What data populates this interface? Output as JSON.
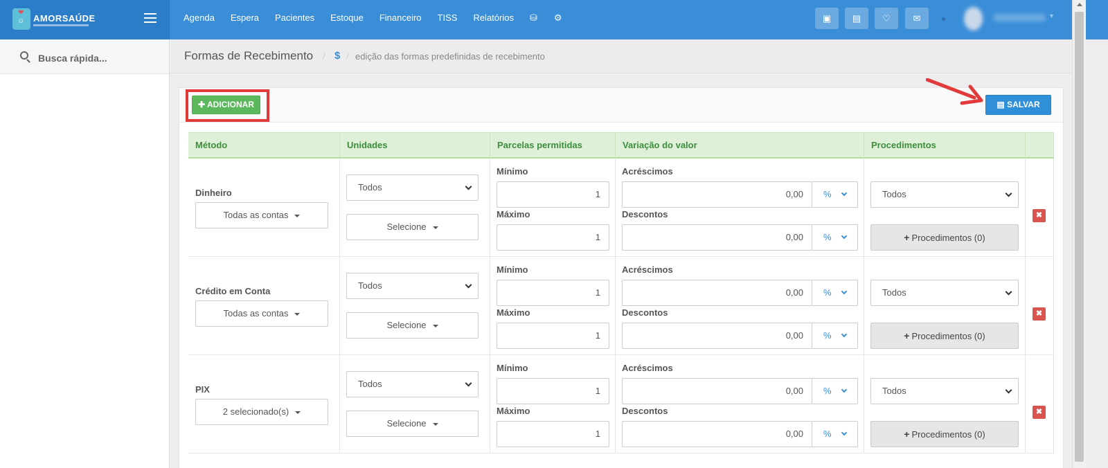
{
  "brand": {
    "name": "AMORSAÚDE"
  },
  "nav": {
    "items": [
      "Agenda",
      "Espera",
      "Pacientes",
      "Estoque",
      "Financeiro",
      "TISS",
      "Relatórios"
    ],
    "icons": [
      "database-icon",
      "gear-icon"
    ]
  },
  "topbar_buttons": [
    "inbox-icon",
    "card-icon",
    "bell-icon",
    "chat-icon"
  ],
  "sidebar": {
    "search_label": "Busca rápida..."
  },
  "page": {
    "title": "Formas de Recebimento",
    "breadcrumb_icon": "$",
    "breadcrumb": "edição das formas predefinidas de recebimento"
  },
  "toolbar": {
    "add_label": "ADICIONAR",
    "save_label": "SALVAR"
  },
  "table": {
    "headers": [
      "Método",
      "Unidades",
      "Parcelas permitidas",
      "Variação do valor",
      "Procedimentos"
    ],
    "labels": {
      "minimo": "Mínimo",
      "maximo": "Máximo",
      "acrescimos": "Acréscimos",
      "descontos": "Descontos",
      "percent": "%",
      "proc_button": "Procedimentos (0)"
    },
    "rows": [
      {
        "method": "Dinheiro",
        "accounts": "Todas as contas",
        "units": "Todos",
        "units_select": "Selecione",
        "min": "1",
        "max": "1",
        "acrescimo": "0,00",
        "desconto": "0,00",
        "procedimentos": "Todos"
      },
      {
        "method": "Crédito em Conta",
        "accounts": "Todas as contas",
        "units": "Todos",
        "units_select": "Selecione",
        "min": "1",
        "max": "1",
        "acrescimo": "0,00",
        "desconto": "0,00",
        "procedimentos": "Todos"
      },
      {
        "method": "PIX",
        "accounts": "2 selecionado(s)",
        "units": "Todos",
        "units_select": "Selecione",
        "min": "1",
        "max": "1",
        "acrescimo": "0,00",
        "desconto": "0,00",
        "procedimentos": "Todos"
      }
    ]
  },
  "colors": {
    "topbar": "#3a8ed8",
    "add": "#5cb85c",
    "save": "#2f8fd8",
    "highlight": "#e03a3a",
    "delete": "#d9534f"
  }
}
